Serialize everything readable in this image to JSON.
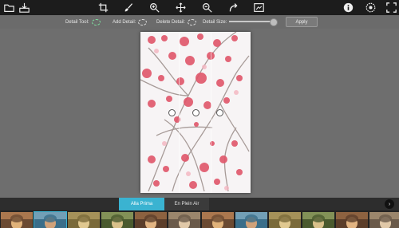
{
  "toolbar": {
    "icons": [
      "open-folder-icon",
      "save-icon",
      "crop-icon",
      "brush-icon",
      "zoom-in-icon",
      "move-icon",
      "zoom-out-icon",
      "rotate-icon",
      "fit-screen-icon",
      "info-icon",
      "settings-icon",
      "fullscreen-icon"
    ]
  },
  "options": {
    "detail_tool_label": "Detail Tool:",
    "add_detail_label": "Add Detail:",
    "delete_detail_label": "Delete Detail:",
    "detail_size_label": "Detail Size:",
    "detail_size_level": 0.92,
    "apply_label": "Apply"
  },
  "style_tabs": {
    "tabs": [
      "Alla Prima",
      "En Plein Air"
    ],
    "active": "Alla Prima"
  },
  "filmstrip": {
    "selected_index": 1,
    "count": 12
  },
  "colors": {
    "accent": "#3ab3d1",
    "topbar": "#1c1c1c",
    "workspace": "#6f6f6f",
    "blossom": "#e0566a"
  }
}
